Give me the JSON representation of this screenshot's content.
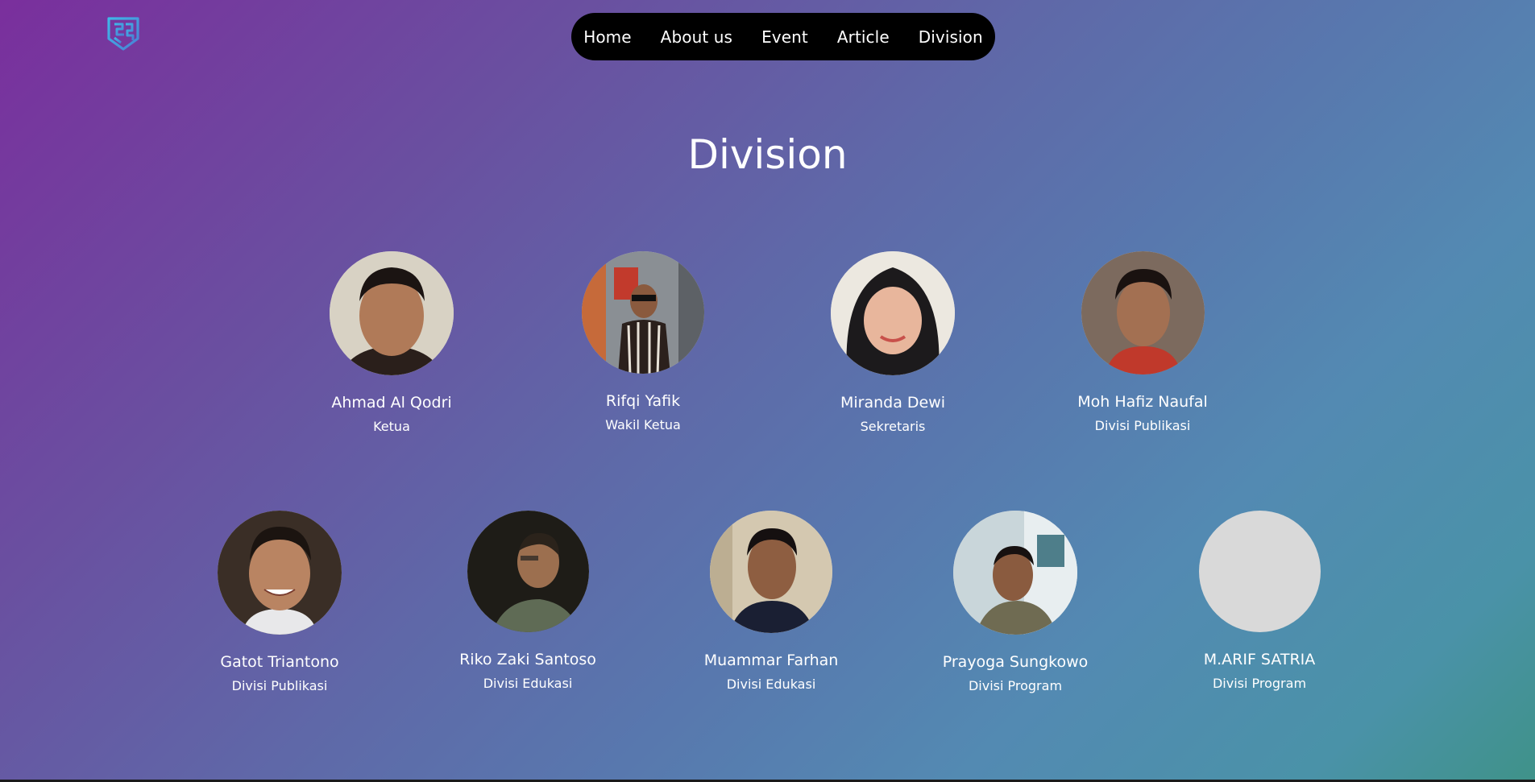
{
  "nav": {
    "items": [
      {
        "label": "Home"
      },
      {
        "label": "About us"
      },
      {
        "label": "Event"
      },
      {
        "label": "Article"
      },
      {
        "label": "Division"
      }
    ]
  },
  "page": {
    "title": "Division"
  },
  "members": [
    {
      "name": "Ahmad Al Qodri",
      "role": "Ketua"
    },
    {
      "name": "Rifqi Yafik",
      "role": "Wakil Ketua"
    },
    {
      "name": "Miranda Dewi",
      "role": "Sekretaris"
    },
    {
      "name": "Moh Hafiz Naufal",
      "role": "Divisi Publikasi"
    },
    {
      "name": "Gatot Triantono",
      "role": "Divisi Publikasi"
    },
    {
      "name": "Riko Zaki Santoso",
      "role": "Divisi Edukasi"
    },
    {
      "name": "Muammar Farhan",
      "role": "Divisi Edukasi"
    },
    {
      "name": "Prayoga Sungkowo",
      "role": "Divisi Program"
    },
    {
      "name": "M.ARIF SATRIA",
      "role": "Divisi Program"
    }
  ],
  "colors": {
    "gradient_start": "#7a2f9d",
    "gradient_mid": "#5878ae",
    "gradient_end": "#3f9289",
    "nav_background": "#000000",
    "logo_accent": "#3fb8e8",
    "placeholder_avatar": "#d9d9d9"
  },
  "icons": {
    "logo": "shield-logo-icon"
  }
}
